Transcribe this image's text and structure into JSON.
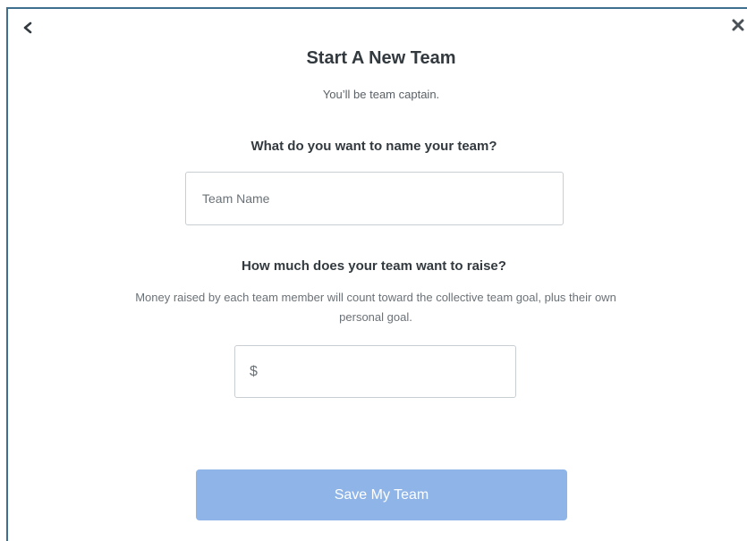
{
  "modal": {
    "title": "Start A New Team",
    "subtitle": "You’ll be team captain.",
    "back_icon": "chevron-left-icon",
    "close_icon": "close-icon"
  },
  "team_name": {
    "question": "What do you want to name your team?",
    "placeholder": "Team Name",
    "value": ""
  },
  "team_goal": {
    "question": "How much does your team want to raise?",
    "description": "Money raised by each team member will count toward the collective team goal, plus their own personal goal.",
    "currency_symbol": "$",
    "value": ""
  },
  "save_button": {
    "label": "Save My Team",
    "color": "#8fb4e8",
    "enabled": false
  }
}
